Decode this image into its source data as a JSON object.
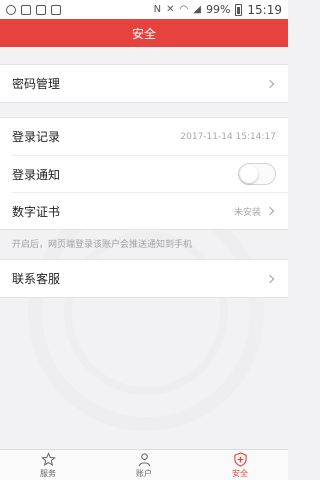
{
  "status_bar": {
    "battery_text": "99%",
    "time": "15:19"
  },
  "header": {
    "title": "安全"
  },
  "sections": {
    "password": {
      "label": "密码管理"
    },
    "login_record": {
      "label": "登录记录",
      "value": "2017-11-14 15:14:17"
    },
    "login_notify": {
      "label": "登录通知",
      "enabled": false
    },
    "certificate": {
      "label": "数字证书",
      "value": "未安装"
    },
    "hint": "开启后，网页端登录该账户会推送通知到手机",
    "support": {
      "label": "联系客服"
    }
  },
  "tabbar": {
    "items": [
      {
        "label": "服务",
        "icon": "star-icon",
        "active": false
      },
      {
        "label": "账户",
        "icon": "person-icon",
        "active": false
      },
      {
        "label": "安全",
        "icon": "shield-plus-icon",
        "active": true
      }
    ]
  },
  "colors": {
    "accent": "#e6433f",
    "background": "#f2f2f4"
  }
}
